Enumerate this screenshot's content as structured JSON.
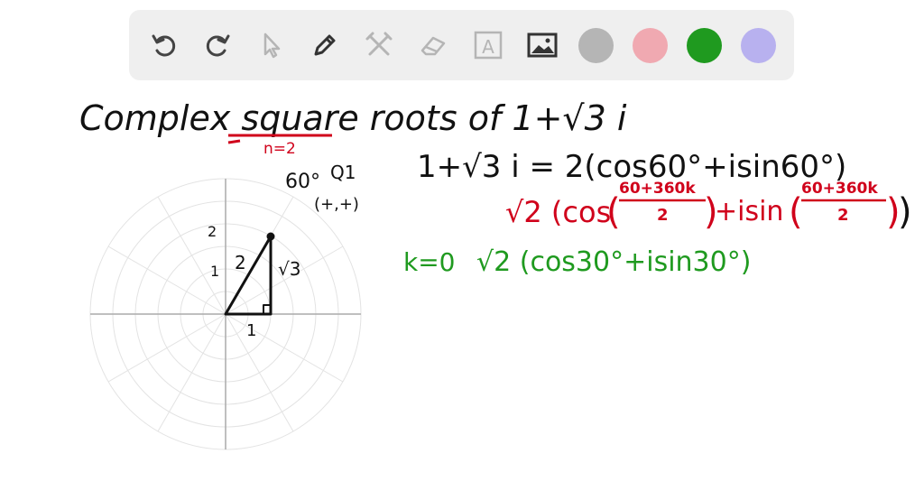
{
  "toolbar": {
    "tools": [
      {
        "name": "undo-button"
      },
      {
        "name": "redo-button"
      },
      {
        "name": "select-button"
      },
      {
        "name": "pen-button"
      },
      {
        "name": "tools-button"
      },
      {
        "name": "eraser-button"
      },
      {
        "name": "text-button",
        "label": "A"
      },
      {
        "name": "image-button"
      }
    ],
    "colors": [
      "#b5b5b5",
      "#f0a9b1",
      "#1f9a1f",
      "#b8b1ef"
    ]
  },
  "board": {
    "title": "Complex square roots of 1+√3 i",
    "n_note": "n=2",
    "quadrant": {
      "angle": "60°",
      "q": "Q1",
      "signs": "(+,+)"
    },
    "triangle": {
      "hyp": "2",
      "leg_v": "√3",
      "leg_h": "1",
      "y_tick_2": "2",
      "y_tick_1": "1"
    },
    "eq1": "1+√3 i = 2(cos60°+isin60°)",
    "eq2_prefix": "√2 (cos",
    "eq2_frac_num": "60+360k",
    "eq2_frac_den": "2",
    "eq2_mid": "+isin",
    "eq3_k": "k=0",
    "eq3": "√2 (cos30°+isin30°)"
  }
}
